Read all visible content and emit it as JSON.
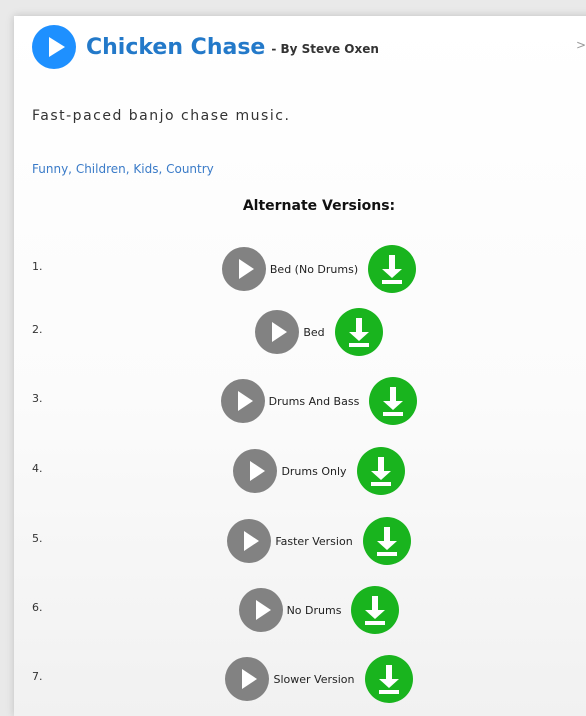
{
  "track": {
    "title": "Chicken Chase",
    "byline": "- By Steve Oxen",
    "description": "Fast-paced banjo chase music.",
    "tags": [
      "Funny",
      "Children",
      "Kids",
      "Country"
    ],
    "nav_glyph": ">",
    "accent_color": "#1e90ff"
  },
  "alternates": {
    "heading": "Alternate Versions:",
    "play_icon": "play-icon",
    "download_icon": "download-icon",
    "download_color": "#19b41e",
    "items": [
      {
        "number": "1.",
        "label": "Bed (No Drums)"
      },
      {
        "number": "2.",
        "label": "Bed"
      },
      {
        "number": "3.",
        "label": "Drums And Bass"
      },
      {
        "number": "4.",
        "label": "Drums Only"
      },
      {
        "number": "5.",
        "label": "Faster Version"
      },
      {
        "number": "6.",
        "label": "No Drums"
      },
      {
        "number": "7.",
        "label": "Slower Version"
      }
    ]
  }
}
